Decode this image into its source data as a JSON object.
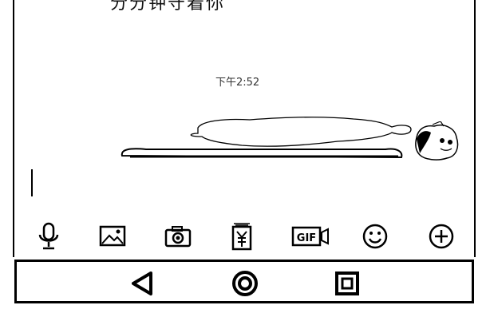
{
  "chat": {
    "previous_message": "分分钟守着你",
    "timestamp": "下午2:52"
  },
  "icons": {
    "toolbar": [
      "microphone-icon",
      "image-icon",
      "camera-icon",
      "red-packet-icon",
      "gif-icon",
      "emoji-icon",
      "plus-icon"
    ],
    "nav": [
      "back-icon",
      "home-icon",
      "recents-icon"
    ]
  },
  "labels": {
    "gif": "GIF"
  }
}
